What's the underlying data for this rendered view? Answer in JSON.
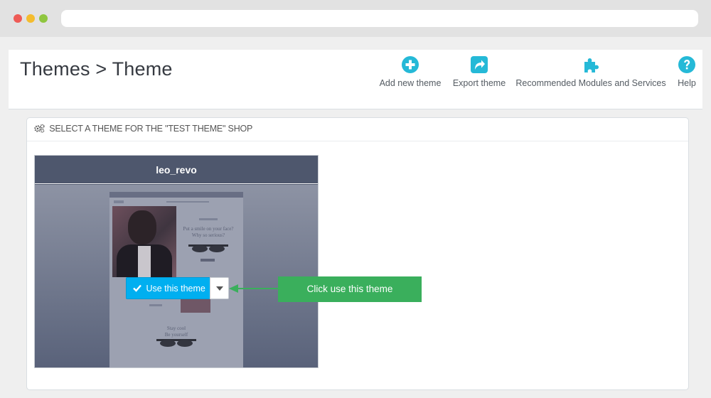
{
  "browser": {
    "controls": [
      "close",
      "minimize",
      "maximize"
    ]
  },
  "header": {
    "title": "Themes > Theme",
    "toolbar": [
      {
        "label": "Add new theme",
        "icon": "plus-circle-icon"
      },
      {
        "label": "Export theme",
        "icon": "share-icon"
      },
      {
        "label": "Recommended Modules and Services",
        "icon": "puzzle-icon"
      },
      {
        "label": "Help",
        "icon": "question-circle-icon"
      }
    ]
  },
  "panel": {
    "heading": "SELECT A THEME FOR THE \"TEST THEME\" SHOP",
    "heading_icon": "cogs-icon"
  },
  "theme_card": {
    "name": "leo_revo",
    "use_button_label": "Use this theme",
    "dropdown_icon": "caret-down-icon"
  },
  "thumbnail": {
    "text_1": "Put a smile on your face?",
    "text_2": "Why so serious?",
    "text_3": "Stay cool",
    "text_4": "Be yourself"
  },
  "annotation": {
    "callout": "Click use this theme"
  },
  "colors": {
    "accent_blue": "#25b9d7",
    "button_blue": "#00aff0",
    "callout_green": "#3aaf5c",
    "card_header": "#4e576d"
  }
}
